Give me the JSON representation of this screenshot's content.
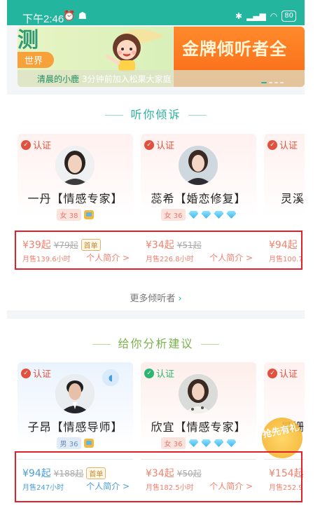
{
  "status_bar": {
    "time": "下午2:46",
    "battery": "80"
  },
  "banner": {
    "left_title": "测",
    "left_pill": "世界",
    "right_title": "金牌倾听者全",
    "ticker_name": "清晨的小鹿",
    "ticker_message": "3分钟前加入松果大家庭"
  },
  "section1": {
    "title": "听你倾诉",
    "more_label": "更多倾听者",
    "cards": [
      {
        "verify": "认证",
        "name": "一丹【情感专家】",
        "gender_age": "女 38",
        "price": "¥39起",
        "old_price": "¥79起",
        "first_tag": "首单",
        "sales": "月售139.6小时",
        "intro": "个人简介 >"
      },
      {
        "verify": "认证",
        "name": "蕊希【婚恋修复】",
        "gender_age": "女 36",
        "price": "¥34起",
        "old_price": "¥51起",
        "sales": "月售226.8小时",
        "intro": "个人简介 >"
      },
      {
        "verify": "认证",
        "name": "灵溪",
        "price": "¥94起",
        "sales": "月售100.7"
      }
    ]
  },
  "section2": {
    "title": "给你分析建议",
    "cards": [
      {
        "verify": "认证",
        "name": "子昂【情感导师】",
        "gender_age": "男 36",
        "price": "¥94起",
        "old_price": "¥188起",
        "first_tag": "首单",
        "sales": "月售247小时",
        "intro": "个人简介 >"
      },
      {
        "verify": "认证",
        "name": "欣宜【情感专家】",
        "gender_age": "女 36",
        "price": "¥34起",
        "old_price": "¥50起",
        "sales": "月售182.5小时",
        "intro": "个人简介 >"
      },
      {
        "verify": "认证",
        "name": "景姗",
        "price": "¥154起",
        "sales": "月售252.9"
      }
    ]
  },
  "float_badge": {
    "text": "抢先有礼"
  },
  "colors": {
    "status_bar": "#23b59d",
    "highlight_box": "#e3202a",
    "price_pink": "#f0826e",
    "price_blue": "#4a9fd8"
  }
}
